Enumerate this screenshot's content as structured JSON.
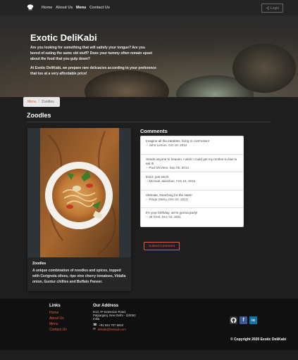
{
  "nav": {
    "items": [
      "Home",
      "About Us",
      "Menu",
      "Contact Us"
    ],
    "login_label": "Login",
    "logo_icon": "chef-hat-icon"
  },
  "hero": {
    "title": "Exotic DeliKabi",
    "lines": [
      "Are you looking for something that will satisfy your tongue? Are you",
      "bored of eating the same old stuff? Does your tummy often remain upset",
      "about the food that you gulp down?"
    ],
    "lines2": [
      "At Exotic DeliKabi, we prepare rare delicacies according to your preference",
      "that too at a very affordable price!"
    ]
  },
  "breadcrumb": {
    "home": "Menu",
    "sep": "/",
    "current": "Zoodles"
  },
  "page_title": "Zoodles",
  "dish": {
    "name": "Zoodles",
    "description": "A unique combination of noodles and spices, topped with Cerignola olives, ripe vine cherry tomatoes, Vidalia onion, Guntur chillies and Buffalo Paneer."
  },
  "comments": {
    "title": "Comments",
    "items": [
      {
        "text": "Imagine all the eatables, living in conFusion!",
        "meta": "-- John Lemon, Oct 16, 2012"
      },
      {
        "text": "Sends anyone to heaven, I wish I could get my mother-in-law to eat it!",
        "meta": "-- Paul McVites, Sep 05, 2014"
      },
      {
        "text": "Eat it, just eat it!",
        "meta": "-- Michael Jaikishan, Feb 15, 2015"
      },
      {
        "text": "Ultimate, Reaching for the stars!",
        "meta": "-- Ringo Starry, Dec 02, 2013"
      },
      {
        "text": "It's your birthday, we're gonna party!",
        "meta": "-- 25 Cent, Dec 02, 2011"
      }
    ],
    "submit_label": "Submit Comment"
  },
  "footer": {
    "links_title": "Links",
    "links": [
      "Home",
      "About Us",
      "Menu",
      "Contact Us"
    ],
    "address_title": "Our Address",
    "address_lines": [
      "D13, IP Extension Road,",
      "Patparganj, New Delhi - 110092",
      "India"
    ],
    "phone": "+91 844 707 6610",
    "email": "dnkabi@hotmail.com",
    "social": [
      "github-icon",
      "facebook-icon",
      "linkedin-icon"
    ],
    "copyright": "© Copyright 2020 Exotic DeliKabi"
  },
  "colors": {
    "accent": "#e65c3c",
    "background": "#1e1e1e",
    "footer": "#101010"
  }
}
